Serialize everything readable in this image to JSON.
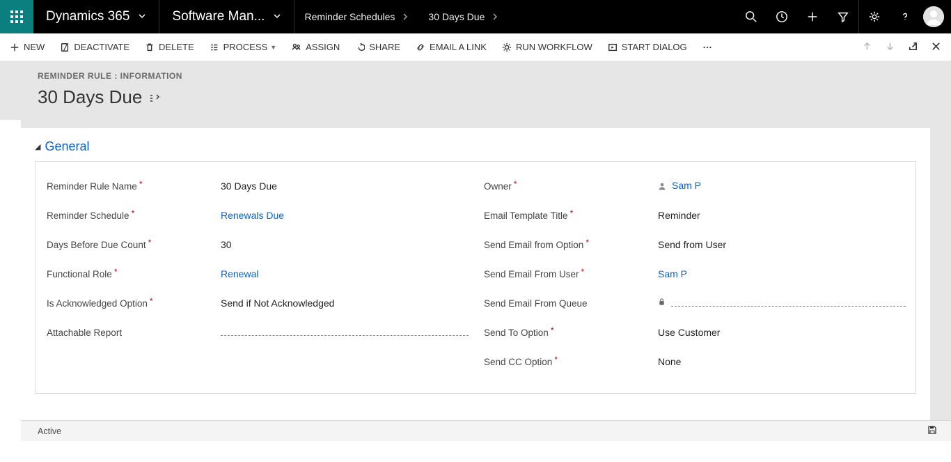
{
  "topbar": {
    "app": "Dynamics 365",
    "module": "Software Man...",
    "crumb1": "Reminder Schedules",
    "crumb2": "30 Days Due"
  },
  "commands": {
    "new": "NEW",
    "deactivate": "DEACTIVATE",
    "delete": "DELETE",
    "process": "PROCESS",
    "assign": "ASSIGN",
    "share": "SHARE",
    "emaillink": "EMAIL A LINK",
    "runwf": "RUN WORKFLOW",
    "startdlg": "START DIALOG"
  },
  "header": {
    "formtype": "REMINDER RULE : INFORMATION",
    "record": "30 Days Due"
  },
  "section": {
    "general": "General"
  },
  "fields_left": {
    "name_lbl": "Reminder Rule Name",
    "name_val": "30 Days Due",
    "sched_lbl": "Reminder Schedule",
    "sched_val": "Renewals Due",
    "days_lbl": "Days Before Due Count",
    "days_val": "30",
    "role_lbl": "Functional Role",
    "role_val": "Renewal",
    "ack_lbl": "Is Acknowledged Option",
    "ack_val": "Send if Not Acknowledged",
    "rep_lbl": "Attachable Report"
  },
  "fields_right": {
    "owner_lbl": "Owner",
    "owner_val": "Sam P",
    "tmpl_lbl": "Email Template Title",
    "tmpl_val": "Reminder",
    "fromopt_lbl": "Send Email from Option",
    "fromopt_val": "Send from User",
    "fromuser_lbl": "Send Email From User",
    "fromuser_val": "Sam P",
    "fromq_lbl": "Send Email From Queue",
    "sendto_lbl": "Send To Option",
    "sendto_val": "Use Customer",
    "sendcc_lbl": "Send CC Option",
    "sendcc_val": "None"
  },
  "status": {
    "text": "Active"
  }
}
